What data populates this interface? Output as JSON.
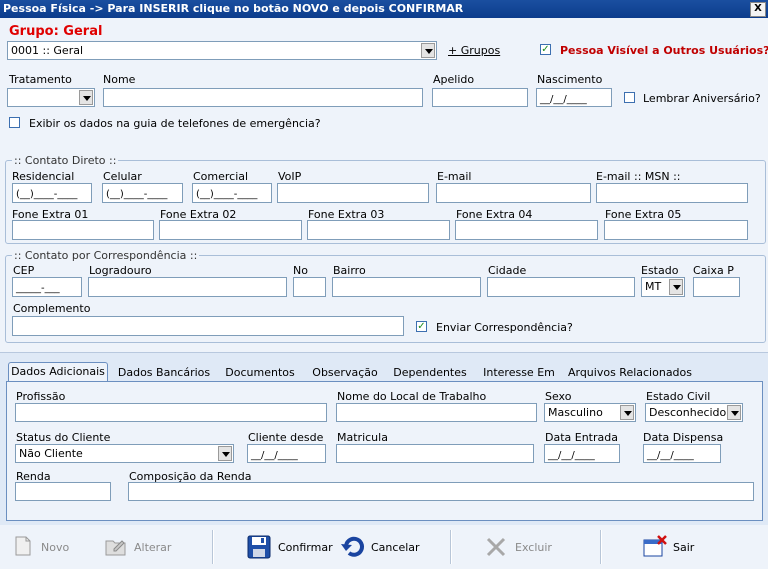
{
  "window": {
    "title": "Pessoa Física -> Para INSERIR clique no botão NOVO e depois CONFIRMAR",
    "close_label": "X"
  },
  "grupo": {
    "label": "Grupo: Geral",
    "select_value": "0001 :: Geral",
    "add_link": "+ Grupos",
    "visivel_label": "Pessoa Visível a Outros Usuários?",
    "visivel_checked": true
  },
  "ident": {
    "tratamento_label": "Tratamento",
    "nome_label": "Nome",
    "apelido_label": "Apelido",
    "nascimento_label": "Nascimento",
    "nascimento_mask": "__/__/____",
    "lembrar_label": "Lembrar Aniversário?",
    "lembrar_checked": false,
    "emerg_label": "Exibir os dados na guia de telefones de emergência?",
    "emerg_checked": false
  },
  "contato": {
    "legend": ":: Contato Direto ::",
    "residencial_label": "Residencial",
    "celular_label": "Celular",
    "comercial_label": "Comercial",
    "voip_label": "VoIP",
    "email_label": "E-mail",
    "msn_label": "E-mail :: MSN ::",
    "phone_mask": "(__)____-____",
    "fone1_label": "Fone Extra 01",
    "fone2_label": "Fone Extra 02",
    "fone3_label": "Fone Extra 03",
    "fone4_label": "Fone Extra 04",
    "fone5_label": "Fone Extra 05"
  },
  "corresp": {
    "legend": ":: Contato por Correspondência ::",
    "cep_label": "CEP",
    "cep_mask": "_____-___",
    "logradouro_label": "Logradouro",
    "no_label": "No",
    "bairro_label": "Bairro",
    "cidade_label": "Cidade",
    "estado_label": "Estado",
    "estado_value": "MT",
    "caixa_label": "Caixa P",
    "complemento_label": "Complemento",
    "enviar_label": "Enviar Correspondência?",
    "enviar_checked": true
  },
  "tabs": [
    "Dados Adicionais",
    "Dados Bancários",
    "Documentos",
    "Observação",
    "Dependentes",
    "Interesse Em",
    "Arquivos Relacionados"
  ],
  "adicionais": {
    "profissao_label": "Profissão",
    "local_label": "Nome do Local de Trabalho",
    "sexo_label": "Sexo",
    "sexo_value": "Masculino",
    "civil_label": "Estado Civil",
    "civil_value": "Desconhecido",
    "status_label": "Status do Cliente",
    "status_value": "Não Cliente",
    "desde_label": "Cliente desde",
    "matricula_label": "Matricula",
    "entrada_label": "Data Entrada",
    "dispensa_label": "Data Dispensa",
    "date_mask": "__/__/____",
    "renda_label": "Renda",
    "composicao_label": "Composição da Renda"
  },
  "toolbar": {
    "novo": "Novo",
    "alterar": "Alterar",
    "confirmar": "Confirmar",
    "cancelar": "Cancelar",
    "excluir": "Excluir",
    "sair": "Sair"
  }
}
